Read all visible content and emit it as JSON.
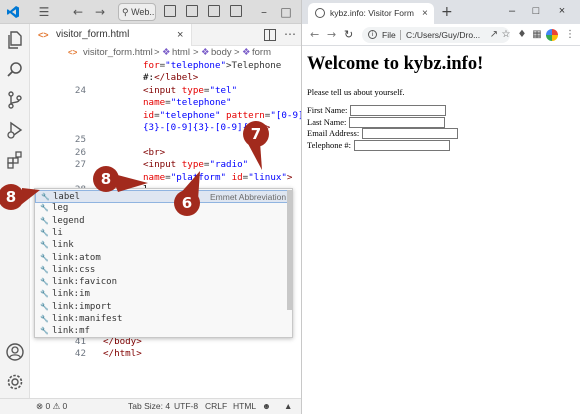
{
  "vscode": {
    "title_search": "Web...",
    "tab": {
      "name": "visitor_form.html"
    },
    "breadcrumb": {
      "file": "visitor_form.html",
      "sep1": ">",
      "html": "html",
      "sep2": ">",
      "body": "body",
      "sep3": ">",
      "form": "form"
    },
    "lines": [
      {
        "num": "",
        "html": "<span class=\"c-attr\">for</span>=<span class=\"c-str\">\"telephone\"</span>&gt;Telephone"
      },
      {
        "num": "",
        "html": "<span class=\"c-txt\">#:</span><span class=\"c-tag\">&lt;/label&gt;</span>"
      },
      {
        "num": "24",
        "html": "<span class=\"c-tag\">&lt;input</span> <span class=\"c-attr\">type</span>=<span class=\"c-str\">\"tel\"</span>"
      },
      {
        "num": "",
        "html": "<span class=\"c-attr\">name</span>=<span class=\"c-str\">\"telephone\"</span>"
      },
      {
        "num": "",
        "html": "<span class=\"c-attr\">id</span>=<span class=\"c-str\">\"telephone\"</span> <span class=\"c-attr\">pattern</span>=<span class=\"c-str\">\"[0-9]</span>"
      },
      {
        "num": "",
        "html": "<span class=\"c-str\">{3}-[0-9]{3}-[0-9]{4}\"</span><span class=\"c-tag\">&gt;</span>"
      },
      {
        "num": "25",
        "html": ""
      },
      {
        "num": "26",
        "html": "<span class=\"c-tag\">&lt;br&gt;</span>"
      },
      {
        "num": "27",
        "html": "<span class=\"c-tag\">&lt;input</span> <span class=\"c-attr\">type</span>=<span class=\"c-str\">\"radio\"</span>"
      },
      {
        "num": "",
        "html": "<span class=\"c-attr\">name</span>=<span class=\"c-str\">\"platform\"</span> <span class=\"c-attr\">id</span>=<span class=\"c-str\">\"linux\"</span><span class=\"c-tag\">&gt;</span>"
      },
      {
        "num": "28",
        "html": "<span class=\"c-txt\">l</span>"
      }
    ],
    "bottom_lines": [
      {
        "num": "41",
        "html": "<span class=\"c-tag\">&lt;/body&gt;</span>"
      },
      {
        "num": "42",
        "html": "<span class=\"c-tag\">&lt;/html&gt;</span>"
      }
    ],
    "suggestions": [
      {
        "label": "label",
        "detail": "Emmet Abbreviation",
        "selected": true
      },
      {
        "label": "leg",
        "detail": ""
      },
      {
        "label": "legend",
        "detail": ""
      },
      {
        "label": "li",
        "detail": ""
      },
      {
        "label": "link",
        "detail": ""
      },
      {
        "label": "link:atom",
        "detail": ""
      },
      {
        "label": "link:css",
        "detail": ""
      },
      {
        "label": "link:favicon",
        "detail": ""
      },
      {
        "label": "link:im",
        "detail": ""
      },
      {
        "label": "link:import",
        "detail": ""
      },
      {
        "label": "link:manifest",
        "detail": ""
      },
      {
        "label": "link:mf",
        "detail": ""
      }
    ],
    "status": {
      "problems": "⊗ 0 ⚠ 0",
      "tab_size": "Tab Size: 4",
      "encoding": "UTF-8",
      "eol": "CRLF",
      "language": "HTML"
    }
  },
  "callouts": [
    {
      "id": "callout-8-left",
      "text": "8"
    },
    {
      "id": "callout-8-mid",
      "text": "8"
    },
    {
      "id": "callout-6",
      "text": "6"
    },
    {
      "id": "callout-7",
      "text": "7"
    }
  ],
  "browser": {
    "tab_title": "kybz.info: Visitor Form",
    "address_scheme": "File",
    "address_url": "C:/Users/Guy/Dro...",
    "page": {
      "heading": "Welcome to kybz.info!",
      "intro": "Please tell us about yourself.",
      "fields": [
        {
          "label": "First Name:"
        },
        {
          "label": "Last Name:"
        },
        {
          "label": "Email Address:"
        },
        {
          "label": "Telephone #:"
        }
      ]
    }
  },
  "colors": {
    "callout": "#a22a1d",
    "vscode_accent": "#0078d4"
  }
}
